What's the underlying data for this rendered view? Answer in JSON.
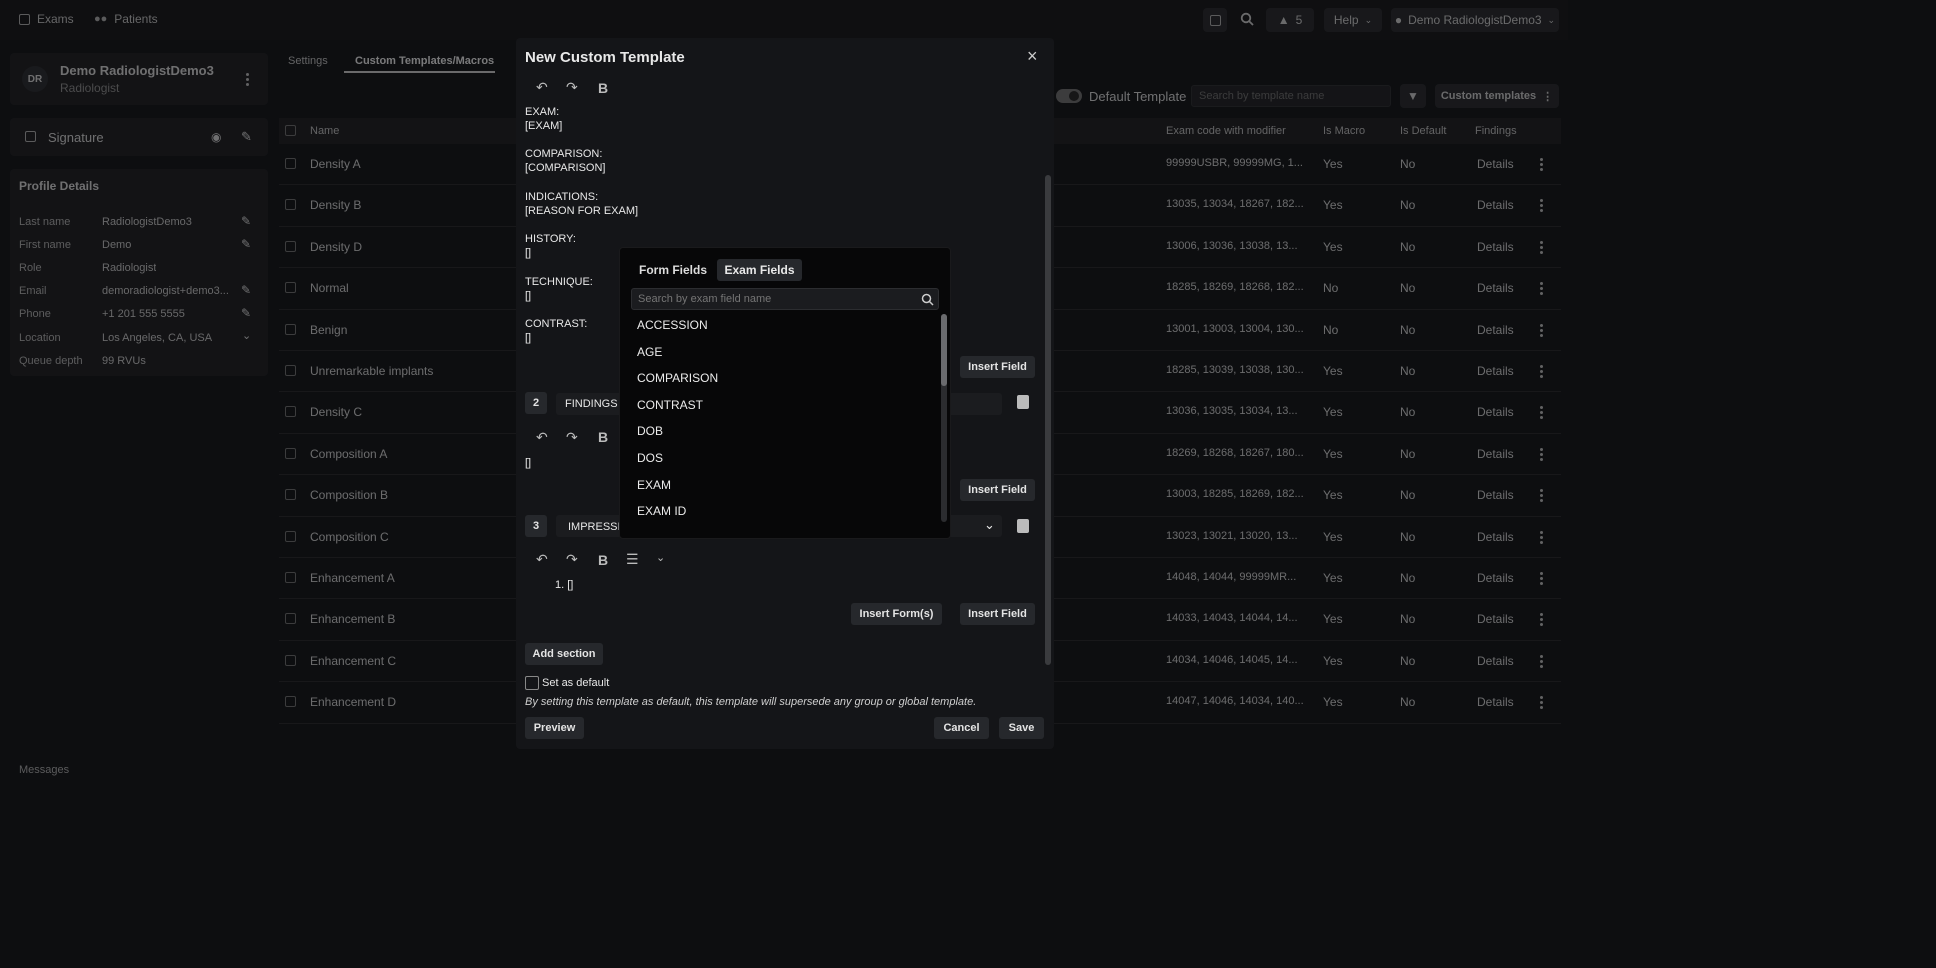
{
  "topbar": {
    "nav": [
      "Exams",
      "Patients"
    ],
    "notifications": "5",
    "help": "Help",
    "user": "Demo RadiologistDemo3"
  },
  "profile": {
    "initials": "DR",
    "name": "Demo RadiologistDemo3",
    "role": "Radiologist"
  },
  "signature": {
    "label": "Signature"
  },
  "details": {
    "title": "Profile Details",
    "fields": [
      {
        "label": "Last name",
        "value": "RadiologistDemo3"
      },
      {
        "label": "First name",
        "value": "Demo"
      },
      {
        "label": "Role",
        "value": "Radiologist"
      },
      {
        "label": "Email",
        "value": "demoradiologist+demo3..."
      },
      {
        "label": "Phone",
        "value": "+1 201 555 5555"
      },
      {
        "label": "Location",
        "value": "Los Angeles, CA, USA"
      },
      {
        "label": "Queue depth",
        "value": "99 RVUs"
      }
    ]
  },
  "tabs": [
    "Settings",
    "Custom Templates/Macros"
  ],
  "toolbar": {
    "default_template": "Default Template",
    "search_placeholder": "Search by template name",
    "custom_templates": "Custom templates"
  },
  "table": {
    "headers": [
      "Name",
      "Exam code with modifier",
      "Is Macro",
      "Is Default",
      "Findings"
    ],
    "rows": [
      {
        "name": "Density A",
        "codes": "99999USBR, 99999MG, 1...",
        "macro": "Yes",
        "default": "No",
        "findings": "Details"
      },
      {
        "name": "Density B",
        "codes": "13035, 13034, 18267, 182...",
        "macro": "Yes",
        "default": "No",
        "findings": "Details"
      },
      {
        "name": "Density D",
        "codes": "13006, 13036, 13038, 13...",
        "macro": "Yes",
        "default": "No",
        "findings": "Details"
      },
      {
        "name": "Normal",
        "codes": "18285, 18269, 18268, 182...",
        "macro": "No",
        "default": "No",
        "findings": "Details"
      },
      {
        "name": "Benign",
        "codes": "13001, 13003, 13004, 130...",
        "macro": "No",
        "default": "No",
        "findings": "Details"
      },
      {
        "name": "Unremarkable implants",
        "codes": "18285, 13039, 13038, 130...",
        "macro": "Yes",
        "default": "No",
        "findings": "Details"
      },
      {
        "name": "Density C",
        "codes": "13036, 13035, 13034, 13...",
        "macro": "Yes",
        "default": "No",
        "findings": "Details"
      },
      {
        "name": "Composition A",
        "codes": "18269, 18268, 18267, 180...",
        "macro": "Yes",
        "default": "No",
        "findings": "Details"
      },
      {
        "name": "Composition B",
        "codes": "13003, 18285, 18269, 182...",
        "macro": "Yes",
        "default": "No",
        "findings": "Details"
      },
      {
        "name": "Composition C",
        "codes": "13023, 13021, 13020, 13...",
        "macro": "Yes",
        "default": "No",
        "findings": "Details"
      },
      {
        "name": "Enhancement A",
        "codes": "14048, 14044, 99999MR...",
        "macro": "Yes",
        "default": "No",
        "findings": "Details"
      },
      {
        "name": "Enhancement B",
        "codes": "14033, 14043, 14044, 14...",
        "macro": "Yes",
        "default": "No",
        "findings": "Details"
      },
      {
        "name": "Enhancement C",
        "codes": "14034, 14046, 14045, 14...",
        "macro": "Yes",
        "default": "No",
        "findings": "Details"
      },
      {
        "name": "Enhancement D",
        "codes": "14047, 14046, 14034, 140...",
        "macro": "Yes",
        "default": "No",
        "findings": "Details"
      }
    ]
  },
  "messages": "Messages",
  "modal": {
    "title": "New Custom Template",
    "body_lines": [
      {
        "label": "EXAM:",
        "value": "[EXAM]"
      },
      {
        "label": "COMPARISON:",
        "value": "[COMPARISON]"
      },
      {
        "label": "INDICATIONS:",
        "value": "[REASON FOR EXAM]"
      },
      {
        "label": "HISTORY:",
        "value": "[]"
      },
      {
        "label": "TECHNIQUE:",
        "value": "[]"
      },
      {
        "label": "CONTRAST:",
        "value": "[]"
      }
    ],
    "insert_field": "Insert Field",
    "insert_forms": "Insert Form(s)",
    "section2": {
      "num": "2",
      "title": "FINDINGS",
      "body": "[]"
    },
    "section3": {
      "num": "3",
      "title": "IMPRESSIO",
      "body": "1. []"
    },
    "add_section": "Add section",
    "set_default": "Set as default",
    "default_note": "By setting this template as default, this template will supersede any group or global template.",
    "preview": "Preview",
    "cancel": "Cancel",
    "save": "Save"
  },
  "fields_popup": {
    "tabs": [
      "Form Fields",
      "Exam Fields"
    ],
    "search_placeholder": "Search by exam field name",
    "items": [
      "ACCESSION",
      "AGE",
      "COMPARISON",
      "CONTRAST",
      "DOB",
      "DOS",
      "EXAM",
      "EXAM ID"
    ]
  }
}
